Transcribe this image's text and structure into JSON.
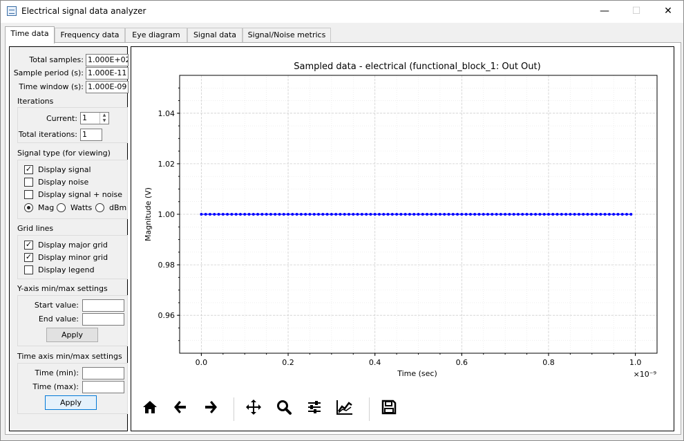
{
  "window": {
    "title": "Electrical signal data analyzer",
    "minimize": "—",
    "maximize": "☐",
    "close": "✕"
  },
  "tabs": [
    "Time data",
    "Frequency data",
    "Eye diagram",
    "Signal data",
    "Signal/Noise metrics"
  ],
  "params": {
    "total_samples_label": "Total samples:",
    "total_samples": "1.000E+02",
    "sample_period_label": "Sample period (s):",
    "sample_period": "1.000E-11",
    "time_window_label": "Time window (s):",
    "time_window": "1.000E-09"
  },
  "iterations": {
    "title": "Iterations",
    "current_label": "Current:",
    "current": "1",
    "total_label": "Total iterations:",
    "total": "1"
  },
  "signal_type": {
    "title": "Signal type (for viewing)",
    "display_signal": "Display signal",
    "display_signal_checked": true,
    "display_noise": "Display noise",
    "display_noise_checked": false,
    "display_signal_noise": "Display signal + noise",
    "display_signal_noise_checked": false,
    "units": [
      "Mag",
      "Watts",
      "dBm"
    ],
    "units_selected": "Mag"
  },
  "grid_lines": {
    "title": "Grid lines",
    "major": "Display major grid",
    "major_checked": true,
    "minor": "Display minor grid",
    "minor_checked": true,
    "legend": "Display legend",
    "legend_checked": false
  },
  "yaxis_settings": {
    "title": "Y-axis min/max settings",
    "start_label": "Start value:",
    "start": "",
    "end_label": "End value:",
    "end": "",
    "apply": "Apply"
  },
  "time_axis_settings": {
    "title": "Time axis min/max settings",
    "min_label": "Time (min):",
    "min": "",
    "max_label": "Time (max):",
    "max": "",
    "apply": "Apply"
  },
  "toolbar": {
    "icons": [
      "home-icon",
      "back-arrow-icon",
      "forward-arrow-icon",
      "pan-icon",
      "zoom-icon",
      "configure-subplots-icon",
      "edit-axis-icon",
      "save-icon"
    ],
    "check_mark": "✓"
  },
  "chart_data": {
    "type": "line",
    "title": "Sampled data - electrical (functional_block_1: Out Out)",
    "xlabel": "Time (sec)",
    "ylabel": "Magnitude (V)",
    "x_multiplier_label": "×10⁻⁹",
    "x_tick_labels": [
      "0.0",
      "0.2",
      "0.4",
      "0.6",
      "0.8",
      "1.0"
    ],
    "y_tick_labels": [
      "0.96",
      "0.98",
      "1.00",
      "1.02",
      "1.04"
    ],
    "xlim": [
      -5e-11,
      1.05e-09
    ],
    "ylim": [
      0.945,
      1.055
    ],
    "major_grid": true,
    "minor_grid": true,
    "series": [
      {
        "color": "#0000ff",
        "marker": "circle",
        "n_points": 100,
        "x_start": 0,
        "x_step": 1e-11,
        "value": 1.0
      }
    ]
  }
}
